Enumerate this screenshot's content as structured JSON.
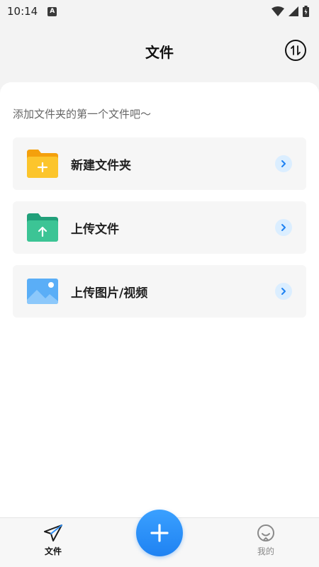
{
  "status_bar": {
    "time": "10:14",
    "notification_badge": "A"
  },
  "header": {
    "title": "文件"
  },
  "main": {
    "hint": "添加文件夹的第一个文件吧～",
    "actions": [
      {
        "label": "新建文件夹",
        "icon": "new-folder-icon",
        "color": "#f8b21c"
      },
      {
        "label": "上传文件",
        "icon": "upload-file-icon",
        "color": "#33b98e"
      },
      {
        "label": "上传图片/视频",
        "icon": "upload-image-icon",
        "color": "#4aa3f5"
      }
    ]
  },
  "bottom_nav": {
    "items": [
      {
        "label": "文件",
        "icon": "paper-plane-icon",
        "active": true
      },
      {
        "label": "我的",
        "icon": "profile-icon",
        "active": false
      }
    ],
    "fab_icon": "plus-icon"
  },
  "colors": {
    "accent": "#1f82f2",
    "chevron_bg": "#dbeeff"
  }
}
